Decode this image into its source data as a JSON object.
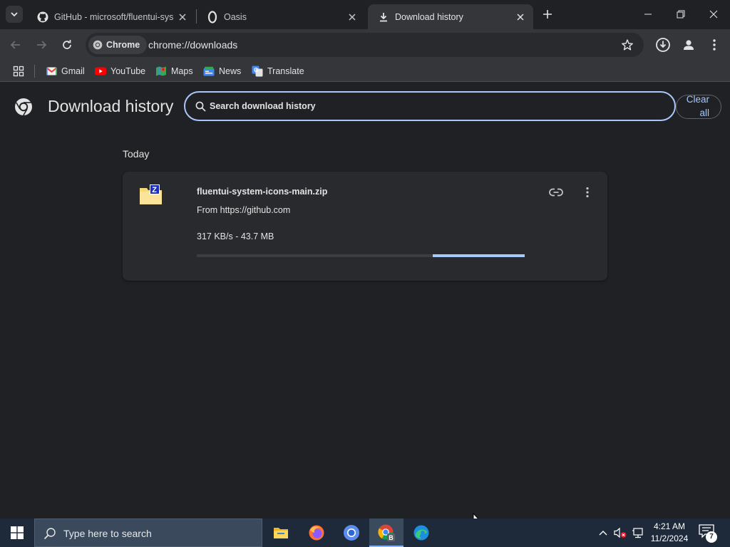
{
  "browser": {
    "tabs": [
      {
        "title": "GitHub - microsoft/fluentui-sys",
        "icon": "github-icon",
        "active": false
      },
      {
        "title": "Oasis",
        "icon": "oasis-icon",
        "active": false
      },
      {
        "title": "Download history",
        "icon": "download-icon",
        "active": true
      }
    ],
    "chip_label": "Chrome",
    "url": "chrome://downloads",
    "bookmarks": [
      {
        "label": "Gmail",
        "icon": "gmail-icon"
      },
      {
        "label": "YouTube",
        "icon": "youtube-icon"
      },
      {
        "label": "Maps",
        "icon": "maps-icon"
      },
      {
        "label": "News",
        "icon": "news-icon"
      },
      {
        "label": "Translate",
        "icon": "translate-icon"
      }
    ]
  },
  "page": {
    "title": "Download history",
    "search_placeholder": "Search download history",
    "clear_all_line1": "Clear",
    "clear_all_line2": "all",
    "date_header": "Today",
    "download": {
      "file_name": "fluentui-system-icons-main.zip",
      "source": "From https://github.com",
      "status": "317 KB/s - 43.7 MB",
      "progress_indeterminate_segment": [
        0.72,
        1.0
      ]
    }
  },
  "taskbar": {
    "search_placeholder": "Type here to search",
    "apps": [
      "file-explorer-icon",
      "firefox-icon",
      "chromium-icon",
      "chrome-icon",
      "edge-icon"
    ],
    "active_app": "chrome-icon",
    "time": "4:21 AM",
    "date": "11/2/2024",
    "notification_count": "7"
  },
  "colors": {
    "accent": "#a8c7fa",
    "page_bg": "#202124",
    "toolbar_bg": "#35363a",
    "taskbar_bg": "#1e2a3a"
  }
}
